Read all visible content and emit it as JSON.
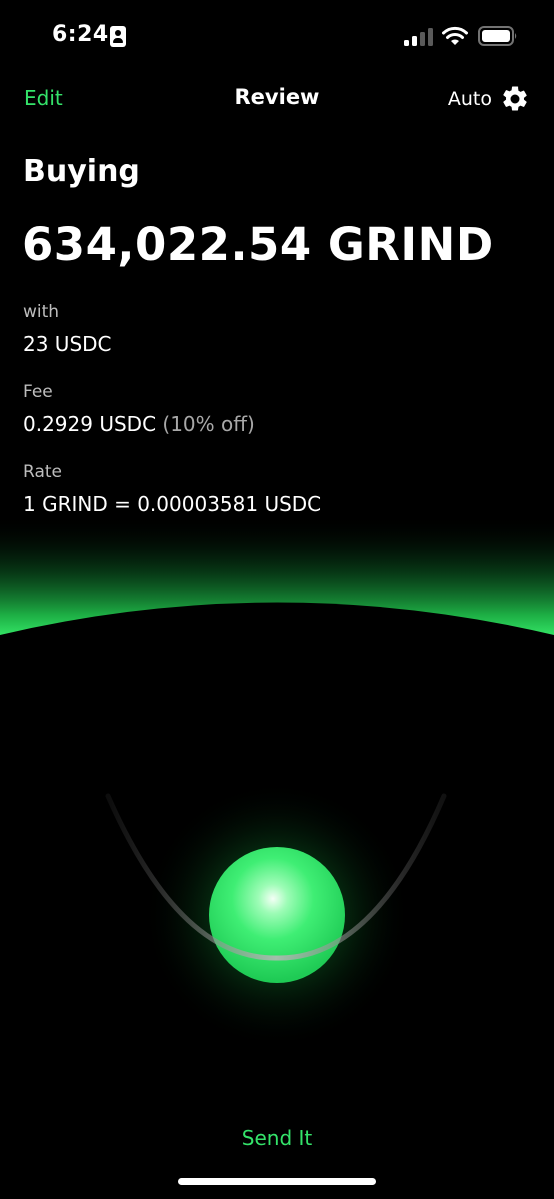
{
  "status_bar": {
    "time": "6:24"
  },
  "nav": {
    "edit_label": "Edit",
    "title": "Review",
    "auto_label": "Auto"
  },
  "trade": {
    "heading": "Buying",
    "amount": "634,022.54 GRIND",
    "with_label": "with",
    "with_value": "23 USDC",
    "fee_label": "Fee",
    "fee_value": "0.2929 USDC",
    "fee_discount": "(10% off)",
    "rate_label": "Rate",
    "rate_value": "1 GRIND = 0.00003581 USDC"
  },
  "actions": {
    "send_label": "Send It"
  },
  "icons": {
    "settings": "gear-icon",
    "signal": "cellular-signal-icon",
    "wifi": "wifi-icon",
    "battery": "battery-icon",
    "badge": "contact-badge-icon"
  },
  "colors": {
    "accent": "#34e36a",
    "background": "#000000",
    "glow": "#22c94f"
  }
}
